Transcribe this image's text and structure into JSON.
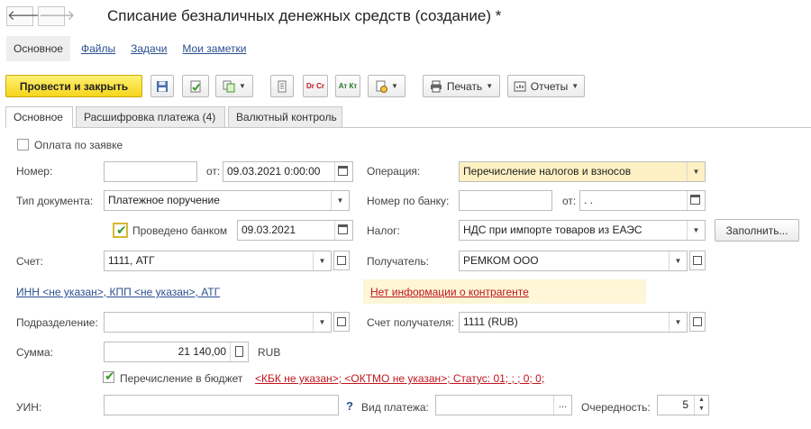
{
  "window": {
    "title": "Списание безналичных денежных средств (создание) *"
  },
  "nav": {
    "back_label": "🡐",
    "forward_label": "🡒"
  },
  "top_nav": {
    "items": [
      "Основное",
      "Файлы",
      "Задачи",
      "Мои заметки"
    ]
  },
  "toolbar": {
    "post_close_label": "Провести и закрыть",
    "dt_cr_label": "Dr Cr",
    "at_kt_label": "Ат Кт",
    "print_label": "Печать",
    "reports_label": "Отчеты",
    "dropdown_glyph": "▼"
  },
  "tabs": [
    "Основное",
    "Расшифровка платежа (4)",
    "Валютный контроль"
  ],
  "form": {
    "pay_by_request_label": "Оплата по заявке",
    "number_label": "Номер:",
    "number_value": "",
    "from_label": "от:",
    "date_value": "09.03.2021  0:00:00",
    "operation_label": "Операция:",
    "operation_value": "Перечисление налогов и взносов",
    "doc_type_label": "Тип документа:",
    "doc_type_value": "Платежное поручение",
    "bank_number_label": "Номер по банку:",
    "bank_number_value": "",
    "bank_from_label": "от:",
    "bank_date_value": " .  .",
    "posted_by_bank_label": "Проведено банком",
    "posted_by_bank_date": "09.03.2021",
    "tax_label": "Налог:",
    "tax_value": "НДС при импорте товаров из ЕАЭС",
    "fill_button_label": "Заполнить...",
    "account_label": "Счет:",
    "account_value": "1111, АТГ",
    "recipient_label": "Получатель:",
    "recipient_value": "РЕМКОМ ООО",
    "inn_link": "ИНН <не указан>, КПП <не указан>, АТГ",
    "no_info_link": "Нет информации о контрагенте",
    "department_label": "Подразделение:",
    "department_value": "",
    "recipient_account_label": "Счет получателя:",
    "recipient_account_value": "1111 (RUB)",
    "sum_label": "Сумма:",
    "sum_value": "21 140,00",
    "currency": "RUB",
    "budget_transfer_label": "Перечисление в бюджет",
    "budget_status_link": "<КБК не указан>; <ОКТМО не указан>; Статус: 01; ; ; 0; 0;",
    "uin_label": "УИН:",
    "uin_value": "",
    "uin_help": "?",
    "payment_kind_label": "Вид платежа:",
    "payment_kind_value": "",
    "ellipsis": "...",
    "priority_label": "Очередность:",
    "priority_value": "5"
  },
  "colors": {
    "primary_button": "#f6d51b",
    "link": "#2a4f8f",
    "warning_link": "#c0151e",
    "highlight_field": "#fdf1c3",
    "check": "#3a9a2a"
  }
}
